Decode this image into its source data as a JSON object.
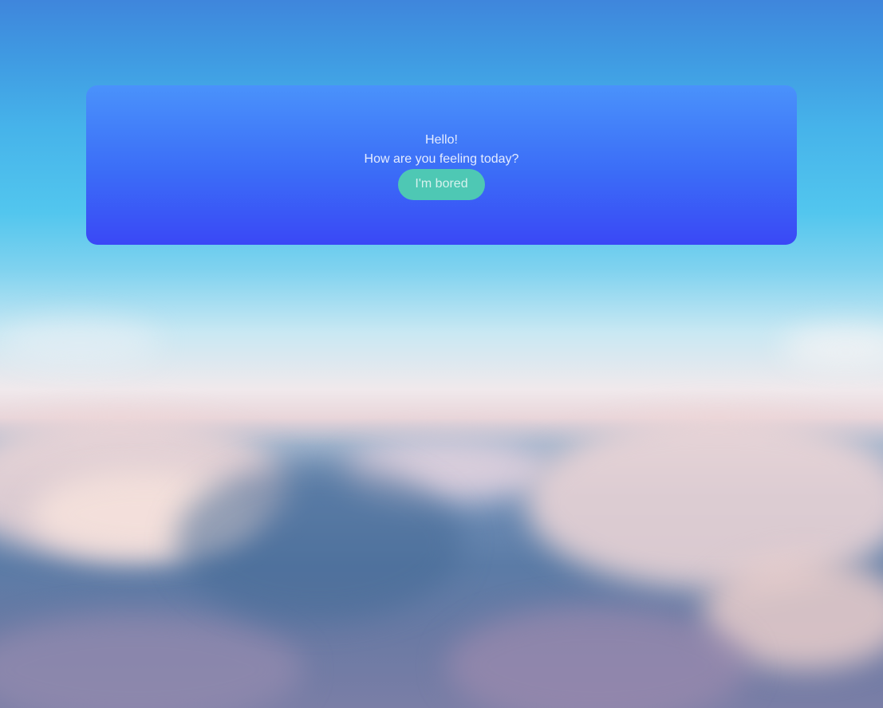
{
  "card": {
    "greeting": "Hello!",
    "question": "How are you feeling today?",
    "button_label": "I'm bored"
  },
  "colors": {
    "card_top": "#4a92fb",
    "card_bottom": "#3a48f6",
    "button": "#4ec8b4",
    "text": "#e4ecff"
  }
}
